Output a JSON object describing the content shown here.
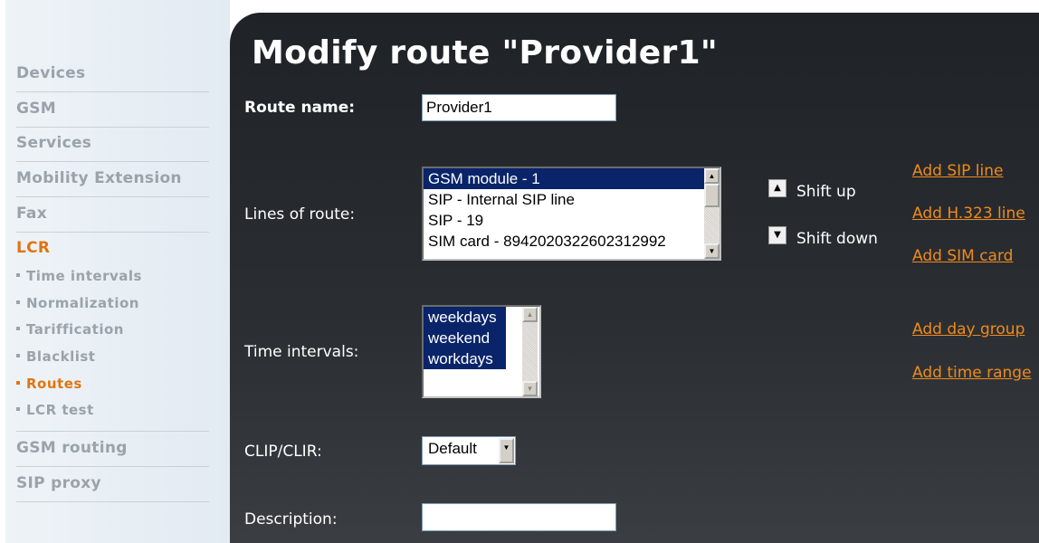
{
  "sidebar": {
    "items": [
      {
        "label": "Devices"
      },
      {
        "label": "GSM"
      },
      {
        "label": "Services"
      },
      {
        "label": "Mobility Extension"
      },
      {
        "label": "Fax"
      },
      {
        "label": "LCR"
      },
      {
        "label": "GSM routing"
      },
      {
        "label": "SIP proxy"
      }
    ],
    "lcr_subitems": [
      {
        "label": "Time intervals"
      },
      {
        "label": "Normalization"
      },
      {
        "label": "Tariffication"
      },
      {
        "label": "Blacklist"
      },
      {
        "label": "Routes"
      },
      {
        "label": "LCR test"
      }
    ],
    "active_item": "LCR",
    "active_subitem": "Routes"
  },
  "main": {
    "title": "Modify route \"Provider1\"",
    "route_name": {
      "label": "Route name:",
      "value": "Provider1"
    },
    "lines_of_route": {
      "label": "Lines of route:",
      "options": [
        {
          "text": "GSM module - 1",
          "selected": true
        },
        {
          "text": "SIP - Internal SIP line",
          "selected": false
        },
        {
          "text": "SIP - 19",
          "selected": false
        },
        {
          "text": "SIM card - 8942020322602312992",
          "selected": false
        }
      ]
    },
    "shift_up_label": "Shift up",
    "shift_down_label": "Shift down",
    "links": {
      "add_sip_line": "Add SIP line",
      "add_h323_line": "Add H.323 line",
      "add_sim_card": "Add SIM card",
      "add_day_group": "Add day group",
      "add_time_range": "Add time range"
    },
    "time_intervals": {
      "label": "Time intervals:",
      "options": [
        {
          "text": "weekdays",
          "selected": true
        },
        {
          "text": "weekend",
          "selected": true
        },
        {
          "text": "workdays",
          "selected": true
        }
      ]
    },
    "clip_clir": {
      "label": "CLIP/CLIR:",
      "value": "Default"
    },
    "description": {
      "label": "Description:",
      "value": ""
    }
  },
  "colors": {
    "accent": "#e07512",
    "link": "#f08a1c",
    "panel_bg": "#24282c",
    "sidebar_bg": "#e8eef3",
    "selection": "#0a246a"
  }
}
